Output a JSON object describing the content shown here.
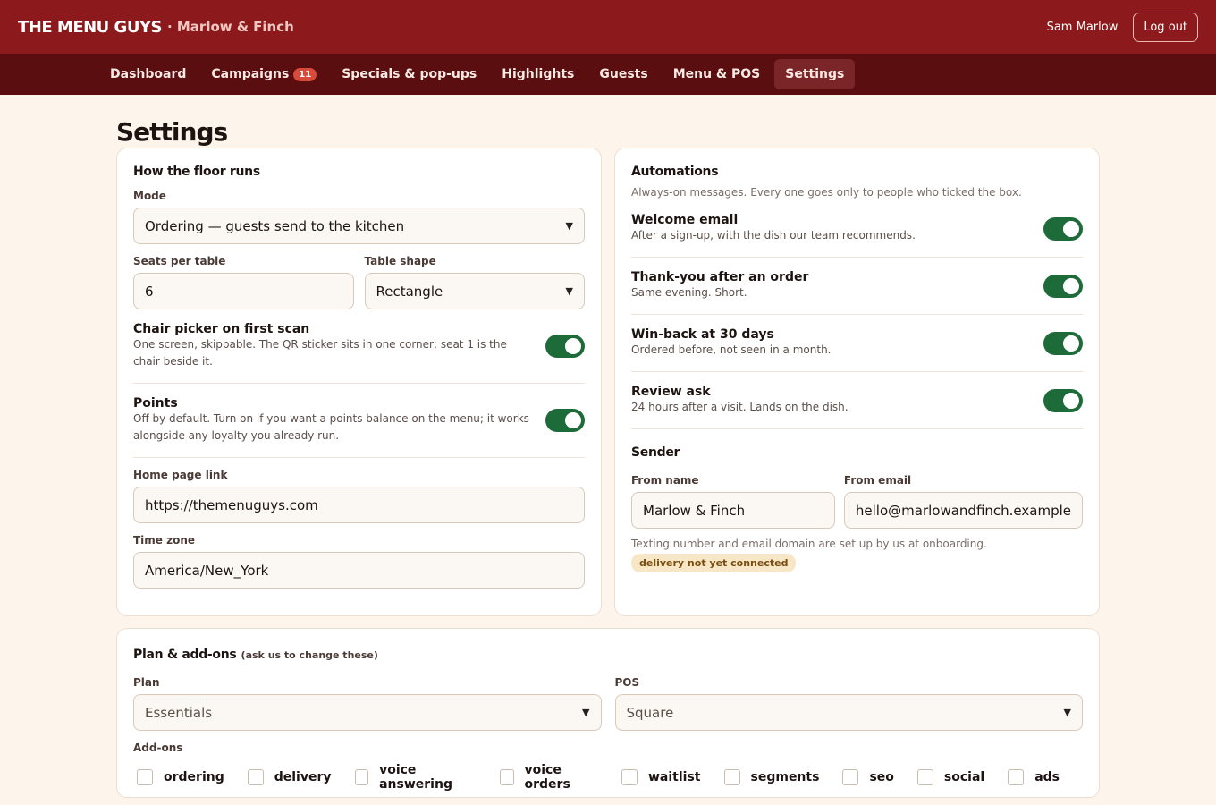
{
  "header": {
    "brand": "THE MENU GUYS",
    "brand_sub": "· Marlow & Finch",
    "user": "Sam Marlow",
    "logout": "Log out"
  },
  "nav": {
    "items": [
      {
        "label": "Dashboard"
      },
      {
        "label": "Campaigns",
        "badge": "11"
      },
      {
        "label": "Specials & pop-ups"
      },
      {
        "label": "Highlights"
      },
      {
        "label": "Guests"
      },
      {
        "label": "Menu & POS"
      },
      {
        "label": "Settings",
        "active": true
      }
    ]
  },
  "page": {
    "title": "Settings"
  },
  "floor": {
    "title": "How the floor runs",
    "mode_label": "Mode",
    "mode_value": "Ordering — guests send to the kitchen",
    "seats_label": "Seats per table",
    "seats_value": "6",
    "shape_label": "Table shape",
    "shape_value": "Rectangle",
    "chair_title": "Chair picker on first scan",
    "chair_desc": "One screen, skippable. The QR sticker sits in one corner; seat 1 is the chair beside it.",
    "chair_on": true,
    "points_title": "Points",
    "points_desc": "Off by default. Turn on if you want a points balance on the menu; it works alongside any loyalty you already run.",
    "points_on": true,
    "home_label": "Home page link",
    "home_value": "https://themenuguys.com",
    "tz_label": "Time zone",
    "tz_value": "America/New_York"
  },
  "automations": {
    "title": "Automations",
    "subtitle": "Always-on messages. Every one goes only to people who ticked the box.",
    "items": [
      {
        "title": "Welcome email",
        "desc": "After a sign-up, with the dish our team recommends.",
        "on": true
      },
      {
        "title": "Thank-you after an order",
        "desc": "Same evening. Short.",
        "on": true
      },
      {
        "title": "Win-back at 30 days",
        "desc": "Ordered before, not seen in a month.",
        "on": true
      },
      {
        "title": "Review ask",
        "desc": "24 hours after a visit. Lands on the dish.",
        "on": true
      }
    ],
    "sender_title": "Sender",
    "from_name_label": "From name",
    "from_name_value": "Marlow & Finch",
    "from_email_label": "From email",
    "from_email_value": "hello@marlowandfinch.example",
    "note": "Texting number and email domain are set up by us at onboarding.",
    "status_pill": "delivery not yet connected"
  },
  "plan": {
    "title": "Plan & add-ons",
    "title_note": "(ask us to change these)",
    "plan_label": "Plan",
    "plan_value": "Essentials",
    "pos_label": "POS",
    "pos_value": "Square",
    "addons_label": "Add-ons",
    "addons": [
      "ordering",
      "delivery",
      "voice answering",
      "voice orders",
      "waitlist",
      "segments",
      "seo",
      "social",
      "ads"
    ]
  },
  "colors": {
    "header_bg": "#8c1a1c",
    "nav_bg": "#5a0e10",
    "toggle_on": "#1e6b3a",
    "page_bg": "#fdf5ec"
  }
}
